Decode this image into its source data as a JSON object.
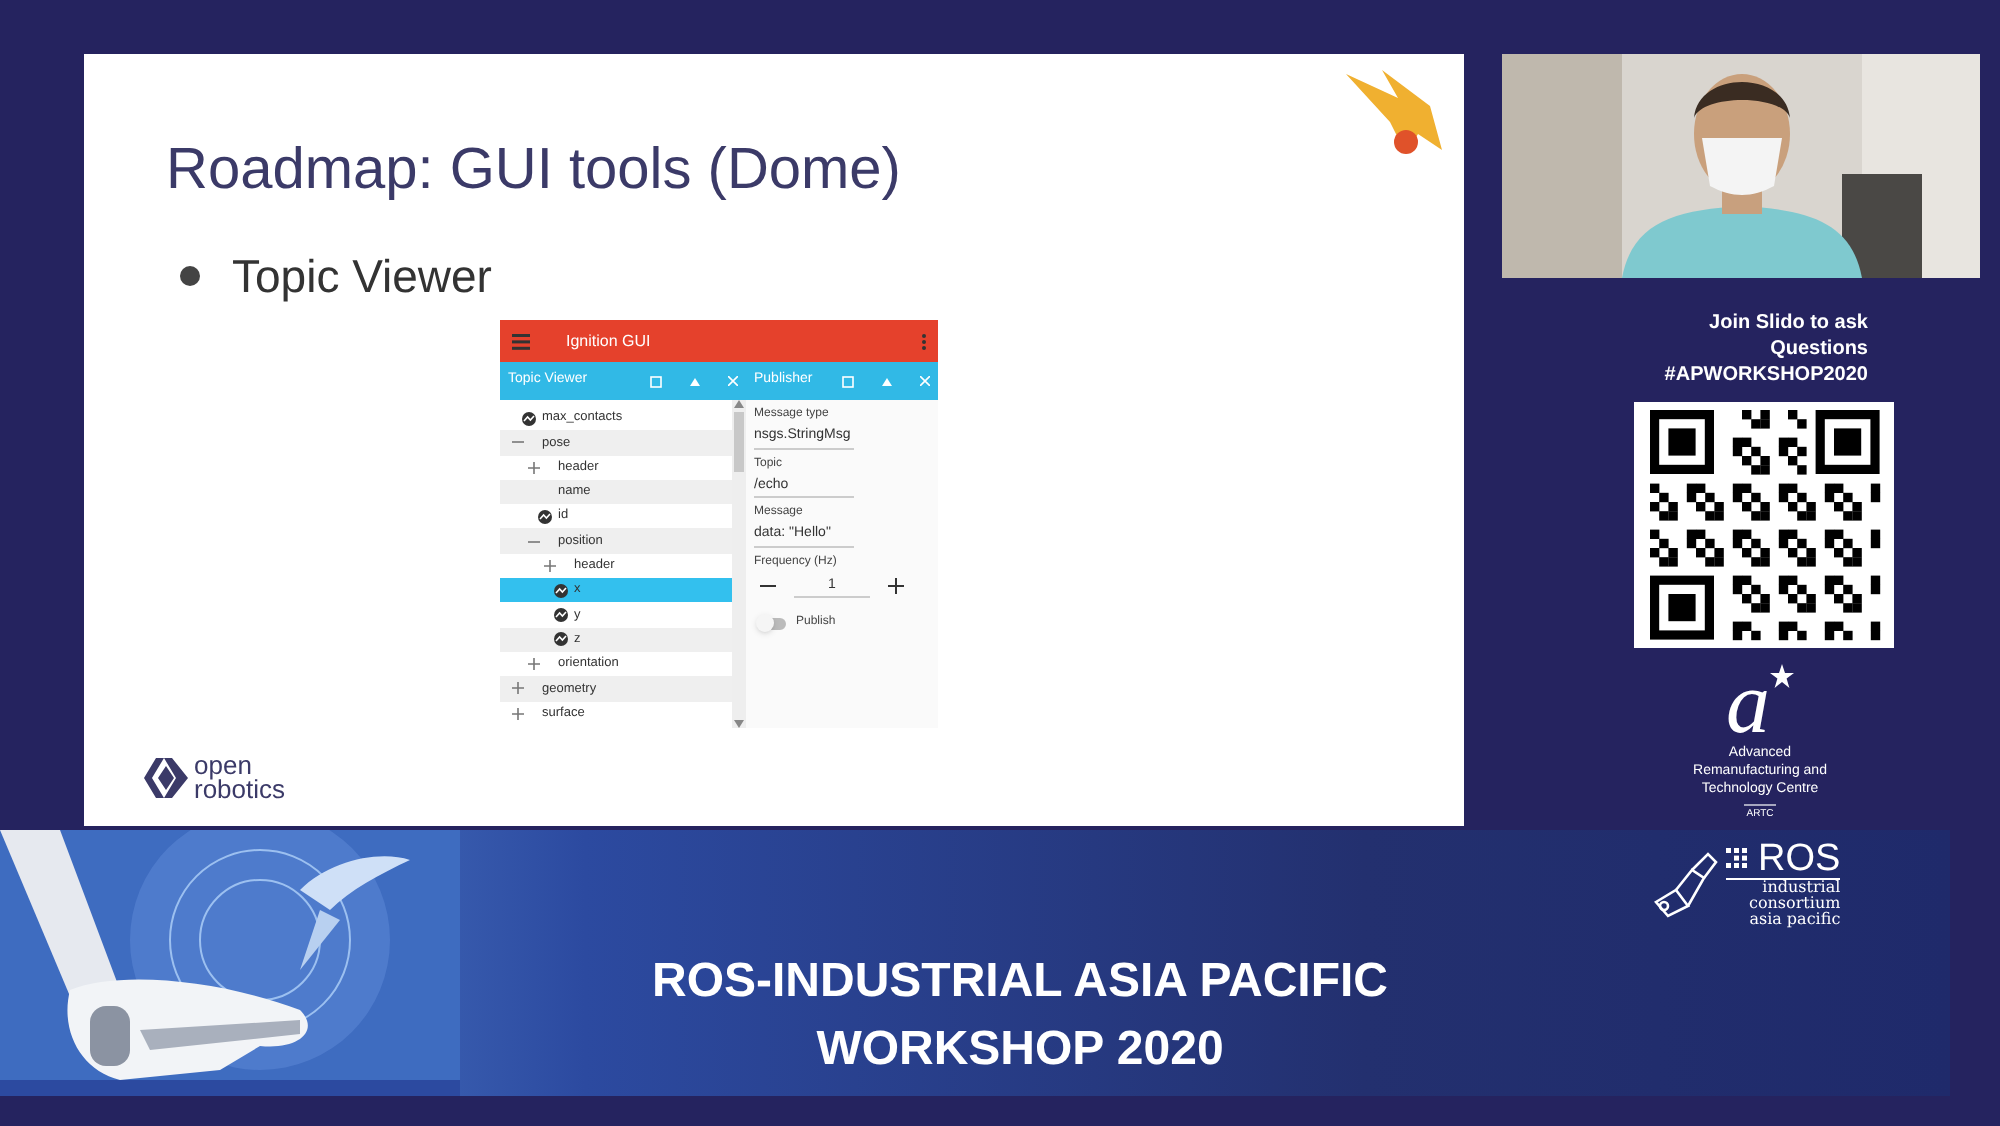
{
  "slide": {
    "title": "Roadmap: GUI tools (Dome)",
    "bullets": [
      "Topic Viewer"
    ],
    "gui": {
      "title": "Ignition GUI",
      "panels": [
        {
          "title": "Topic Viewer"
        },
        {
          "title": "Publisher"
        }
      ],
      "tree": [
        {
          "label": "max_contacts",
          "kind": "plot",
          "selected": false
        },
        {
          "label": "pose",
          "kind": "branch",
          "expanded": true,
          "selected": false,
          "children": [
            {
              "label": "header",
              "kind": "branch",
              "expanded": false,
              "selected": false
            },
            {
              "label": "name",
              "kind": "field",
              "selected": false
            },
            {
              "label": "id",
              "kind": "plot",
              "selected": false
            },
            {
              "label": "position",
              "kind": "branch",
              "expanded": true,
              "selected": false,
              "children": [
                {
                  "label": "header",
                  "kind": "branch",
                  "expanded": false,
                  "selected": false
                },
                {
                  "label": "x",
                  "kind": "plot",
                  "selected": true
                },
                {
                  "label": "y",
                  "kind": "plot",
                  "selected": false
                },
                {
                  "label": "z",
                  "kind": "plot",
                  "selected": false
                }
              ]
            },
            {
              "label": "orientation",
              "kind": "branch",
              "expanded": false,
              "selected": false
            }
          ]
        },
        {
          "label": "geometry",
          "kind": "branch",
          "expanded": false,
          "selected": false
        },
        {
          "label": "surface",
          "kind": "branch",
          "expanded": false,
          "selected": false
        }
      ],
      "publisher": {
        "fields": [
          {
            "label": "Message type",
            "value": "nsgs.StringMsg"
          },
          {
            "label": "Topic",
            "value": "/echo"
          },
          {
            "label": "Message",
            "value": "data: \"Hello\""
          }
        ],
        "frequency": {
          "label": "Frequency (Hz)",
          "value": "1"
        },
        "publish": {
          "label": "Publish",
          "on": false
        }
      }
    },
    "footer_logo": {
      "line1": "open",
      "line2": "robotics"
    }
  },
  "sidebar": {
    "slido": [
      "Join Slido to ask",
      "Questions",
      "#APWORKSHOP2020"
    ],
    "artc": {
      "mark": "a",
      "lines": [
        "Advanced",
        "Remanufacturing and",
        "Technology Centre"
      ],
      "short": "ARTC"
    },
    "ros": {
      "name": "ROS",
      "lines": [
        "industrial",
        "consortium",
        "asia pacific"
      ]
    }
  },
  "banner": {
    "lines": [
      "ROS-INDUSTRIAL ASIA PACIFIC",
      "WORKSHOP 2020"
    ]
  }
}
